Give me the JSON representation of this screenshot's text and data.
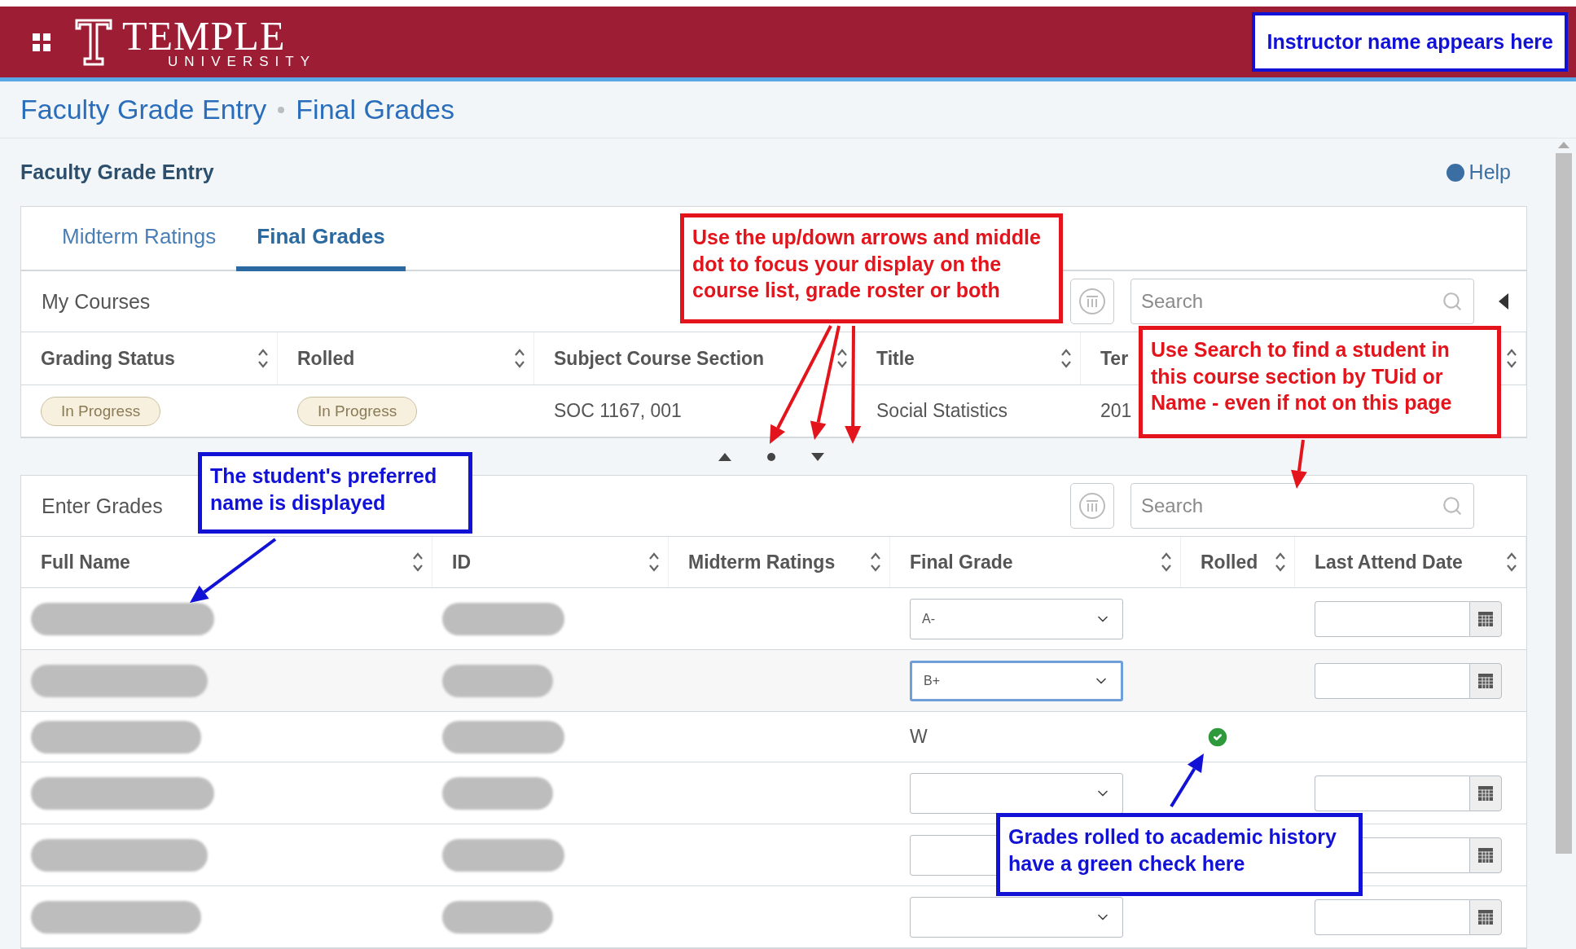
{
  "header": {
    "logo_word": "TEMPLE",
    "logo_sub": "UNIVERSITY",
    "instructor_note": "Instructor name appears here"
  },
  "breadcrumb": [
    "Faculty Grade Entry",
    "Final Grades"
  ],
  "page_title": "Faculty Grade Entry",
  "help": "Help",
  "tabs": [
    {
      "label": "Midterm Ratings",
      "selected": false
    },
    {
      "label": "Final Grades",
      "selected": true
    }
  ],
  "courses": {
    "title": "My Courses",
    "search_placeholder": "Search",
    "columns": [
      "Grading Status",
      "Rolled",
      "Subject Course Section",
      "Title",
      "Ter"
    ],
    "rows": [
      {
        "grading_status": "In Progress",
        "rolled": "In Progress",
        "section": "SOC 1167, 001",
        "title": "Social Statistics",
        "term": "201"
      }
    ]
  },
  "grades": {
    "title": "Enter Grades",
    "search_placeholder": "Search",
    "columns": [
      "Full Name",
      "ID",
      "Midterm Ratings",
      "Final Grade",
      "Rolled",
      "Last Attend Date"
    ],
    "rows": [
      {
        "kind": "select",
        "grade": "A-",
        "focused": false,
        "rolled": false
      },
      {
        "kind": "select",
        "grade": "B+",
        "focused": true,
        "rolled": false
      },
      {
        "kind": "text",
        "grade": "W",
        "focused": false,
        "rolled": true
      },
      {
        "kind": "select",
        "focused": false,
        "rolled": false
      },
      {
        "kind": "select",
        "focused": false
      },
      {
        "kind": "select",
        "focused": false,
        "rolled": false
      }
    ]
  },
  "callouts": [
    {
      "text": "Use the up/down arrows and middle dot to focus your display on the course list, grade roster or both",
      "color": "#e3141b"
    },
    {
      "text": "Use Search to find a student in this course section by TUid or Name - even if not on this page",
      "color": "#e3141b"
    },
    {
      "text": "The student's preferred name is displayed",
      "color": "#1212d6"
    },
    {
      "text": "Grades rolled to academic history have a green check here",
      "color": "#1212d6"
    }
  ]
}
